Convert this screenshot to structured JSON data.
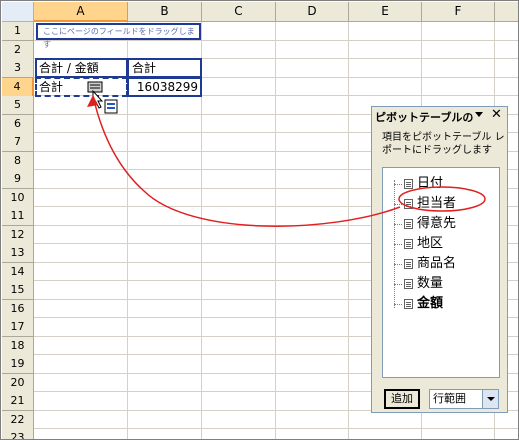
{
  "columns": [
    "A",
    "B",
    "C",
    "D",
    "E",
    "F"
  ],
  "rows": [
    "1",
    "2",
    "3",
    "4",
    "5",
    "6",
    "7",
    "8",
    "9",
    "10",
    "11",
    "12",
    "13",
    "14",
    "15",
    "16",
    "17",
    "18",
    "19",
    "20",
    "21",
    "22",
    "23"
  ],
  "selected_column": "A",
  "selected_row": "4",
  "page_area_text": "ここにページのフィールドをドラッグします",
  "cells": {
    "A3": "合計 / 金額",
    "B3": "合計",
    "A4": "合計",
    "B4": "16038299"
  },
  "panel": {
    "title": "ピボットテーブルの",
    "instructions": "項目をピボットテーブル レポートにドラッグします",
    "fields": [
      {
        "label": "日付",
        "bold": false
      },
      {
        "label": "担当者",
        "bold": false
      },
      {
        "label": "得意先",
        "bold": false
      },
      {
        "label": "地区",
        "bold": false
      },
      {
        "label": "商品名",
        "bold": false
      },
      {
        "label": "数量",
        "bold": false
      },
      {
        "label": "金額",
        "bold": true
      }
    ],
    "add_button": "追加",
    "area_select": "行範囲"
  },
  "colors": {
    "annotation": "#e02020",
    "pivot_border": "#1f3a93",
    "header_selected": "#ffd58d"
  }
}
